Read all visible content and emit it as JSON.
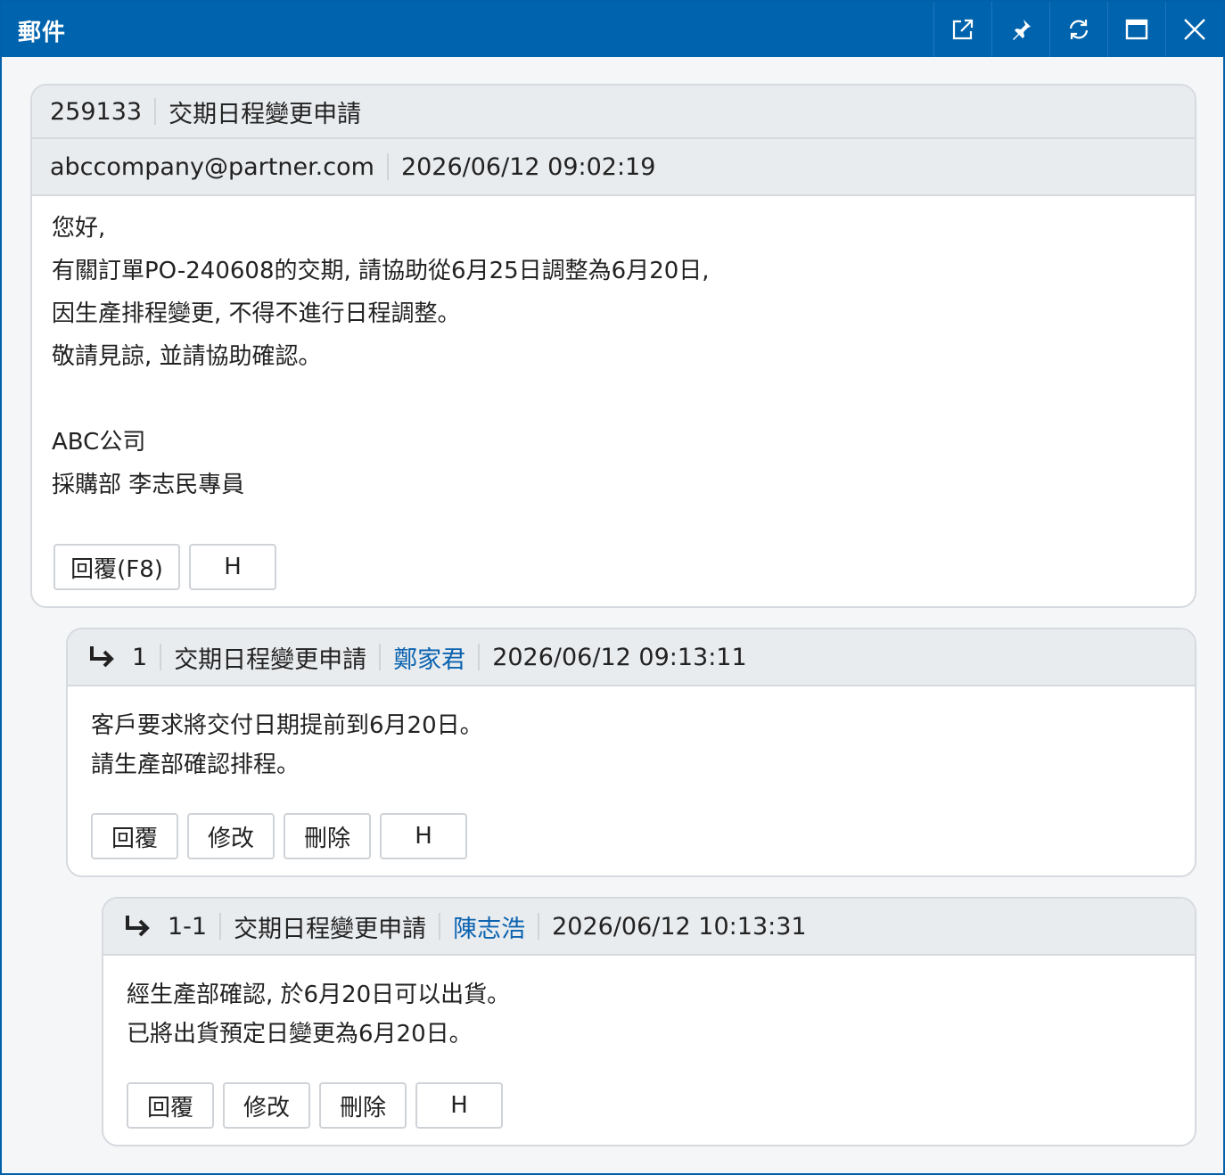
{
  "window": {
    "title": "郵件",
    "tools": [
      {
        "name": "popout-icon"
      },
      {
        "name": "pin-icon"
      },
      {
        "name": "refresh-icon"
      },
      {
        "name": "maximize-icon"
      },
      {
        "name": "close-icon"
      }
    ]
  },
  "mail": {
    "id": "259133",
    "subject": "交期日程變更申請",
    "sender": "abccompany@partner.com",
    "datetime": "2026/06/12 09:02:19",
    "body": [
      "您好,",
      "有關訂單PO-240608的交期, 請協助從6月25日調整為6月20日,",
      "因生產排程變更, 不得不進行日程調整。",
      "敬請見諒, 並請協助確認。",
      "",
      "ABC公司",
      "採購部 李志民專員"
    ],
    "buttons": {
      "reply": "回覆(F8)",
      "h": "H"
    }
  },
  "replies": [
    {
      "number": "1",
      "subject": "交期日程變更申請",
      "author": "鄭家君",
      "datetime": "2026/06/12 09:13:11",
      "body": [
        "客戶要求將交付日期提前到6月20日。",
        "請生產部確認排程。"
      ],
      "buttons": {
        "reply": "回覆",
        "edit": "修改",
        "delete": "刪除",
        "h": "H"
      }
    },
    {
      "number": "1-1",
      "subject": "交期日程變更申請",
      "author": "陳志浩",
      "datetime": "2026/06/12 10:13:31",
      "body": [
        "經生產部確認, 於6月20日可以出貨。",
        "已將出貨預定日變更為6月20日。"
      ],
      "buttons": {
        "reply": "回覆",
        "edit": "修改",
        "delete": "刪除",
        "h": "H"
      }
    }
  ],
  "colors": {
    "titlebar": "#0063ad",
    "link": "#0b63b0"
  }
}
